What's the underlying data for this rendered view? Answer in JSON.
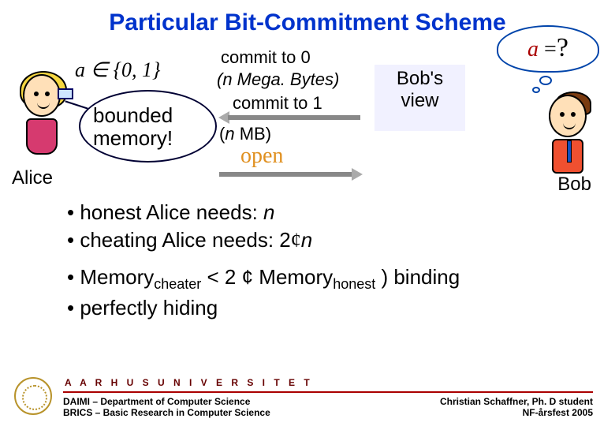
{
  "title": "Particular Bit-Commitment Scheme",
  "formula_a": "a ∈ {0, 1}",
  "messages": {
    "commit0": "commit to 0",
    "size0": "(n Mega. Bytes)",
    "commit1": "commit to 1",
    "size1_prefix": "(",
    "size1_n": "n",
    "size1_suffix": " MB)",
    "open": "open"
  },
  "bobs_view": {
    "line1": "Bob's",
    "line2": "view"
  },
  "thought": {
    "var": "a",
    "eq": " =",
    "q": "?"
  },
  "bounded": {
    "line1": "bounded",
    "line2": "memory!"
  },
  "actors": {
    "alice": "Alice",
    "bob": "Bob"
  },
  "bullets": {
    "b1_pre": "• honest Alice needs:       ",
    "b1_n": "n",
    "b2_pre": "• cheating Alice needs: 2",
    "b2_cent": "¢",
    "b2_n": "n",
    "b3_pre": "• Memory",
    "b3_sub1": "cheater",
    "b3_mid": " < 2 ¢ Memory",
    "b3_sub2": "honest",
    "b3_post": "  ) binding",
    "b4": "• perfectly hiding"
  },
  "footer": {
    "university": "A A R H U S   U N I V E R S I T E T",
    "left1": "DAIMI – Department of Computer Science",
    "left2": "BRICS – Basic Research in Computer Science",
    "right1": "Christian Schaffner, Ph. D student",
    "right2": "NF-årsfest 2005"
  }
}
